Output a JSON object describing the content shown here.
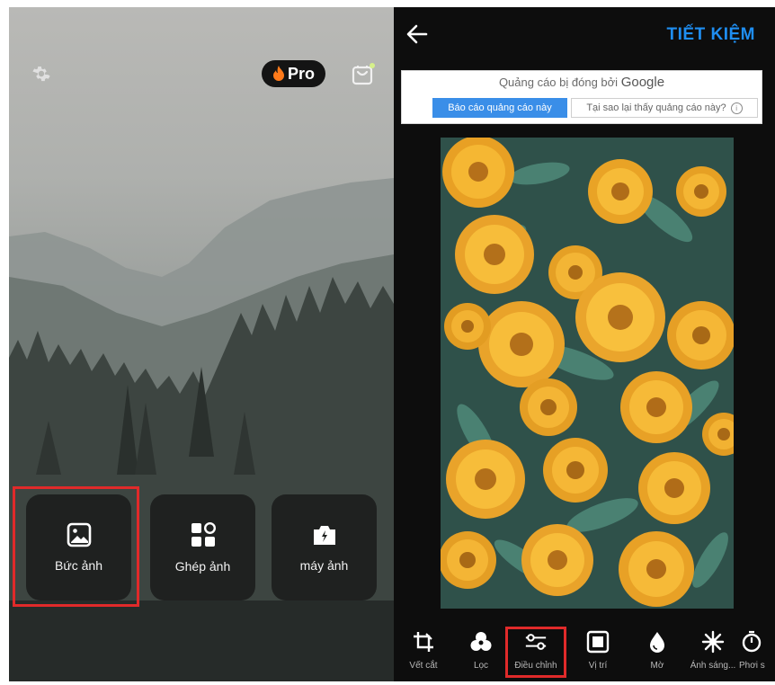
{
  "left_screen": {
    "pro_badge": {
      "label": "Pro",
      "icon": "flame-icon"
    },
    "settings_icon": "gear-icon",
    "store_icon": "shopping-bag-icon",
    "actions": [
      {
        "label": "Bức ảnh",
        "icon": "image-icon"
      },
      {
        "label": "Ghép ảnh",
        "icon": "grid-icon"
      },
      {
        "label": "máy ảnh",
        "icon": "camera-icon"
      }
    ]
  },
  "right_screen": {
    "back_icon": "arrow-left-icon",
    "save_label": "TIẾT KIỆM",
    "ad": {
      "closed_text": "Quảng cáo bị đóng bởi",
      "brand": "Google",
      "report_label": "Báo cáo quảng cáo này",
      "why_label": "Tại sao lại thấy quảng cáo này?"
    },
    "tools": [
      {
        "label": "Vết cắt",
        "icon": "crop-icon"
      },
      {
        "label": "Lọc",
        "icon": "filter-icon"
      },
      {
        "label": "Điều chỉnh",
        "icon": "sliders-icon"
      },
      {
        "label": "Vị trí",
        "icon": "frame-icon"
      },
      {
        "label": "Mờ",
        "icon": "drop-icon"
      },
      {
        "label": "Ánh sáng...",
        "icon": "sparkle-icon"
      },
      {
        "label": "Phơi s",
        "icon": "timer-icon"
      }
    ]
  },
  "colors": {
    "accent": "#1f8ef1",
    "highlight": "#e02a2a",
    "tile_bg": "#1c1e1d"
  }
}
